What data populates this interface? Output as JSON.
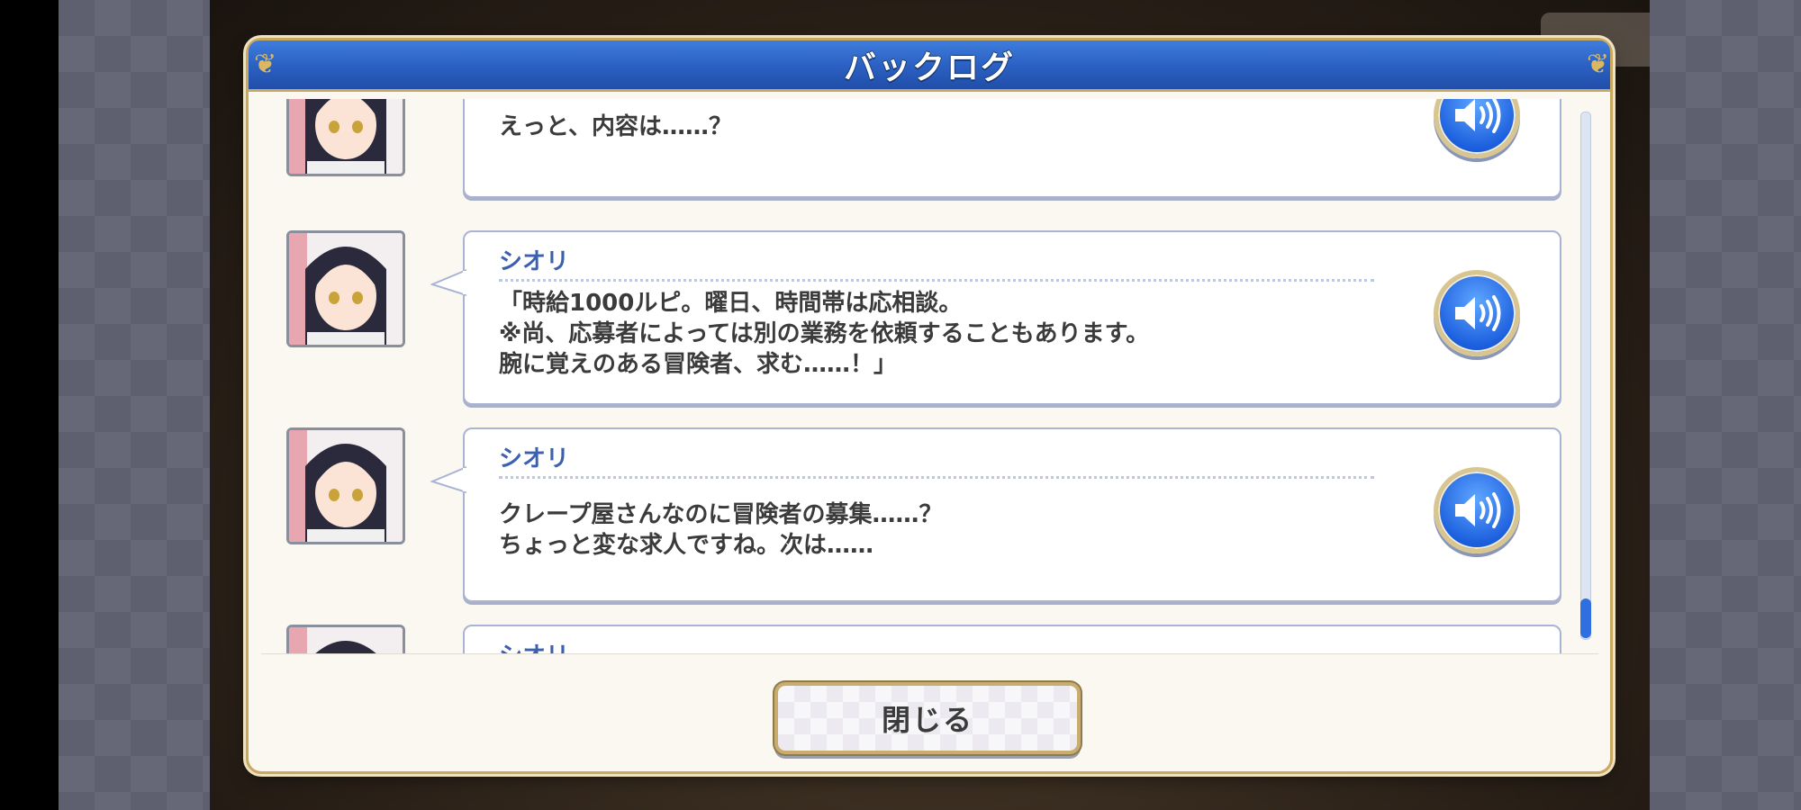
{
  "window": {
    "title": "バックログ"
  },
  "entries": [
    {
      "speaker": "",
      "text": "えっと、内容は……？"
    },
    {
      "speaker": "シオリ",
      "text": "「時給1000ルピ。曜日、時間帯は応相談。\n※尚、応募者によっては別の業務を依頼することもあります。\n腕に覚えのある冒険者、求む……！」"
    },
    {
      "speaker": "シオリ",
      "text": "クレープ屋さんなのに冒険者の募集……？\nちょっと変な求人ですね。次は……"
    },
    {
      "speaker": "シオリ",
      "text": ""
    }
  ],
  "scroll": {
    "position": 0.93
  },
  "footer": {
    "close_label": "閉じる"
  },
  "colors": {
    "header": "#2a5fc1",
    "accent_gold": "#c9a862",
    "speaker": "#3c5fb0",
    "voice_button": "#1c5fde"
  },
  "icons": {
    "voice": "speaker-volume-icon",
    "avatar": "character-portrait"
  }
}
